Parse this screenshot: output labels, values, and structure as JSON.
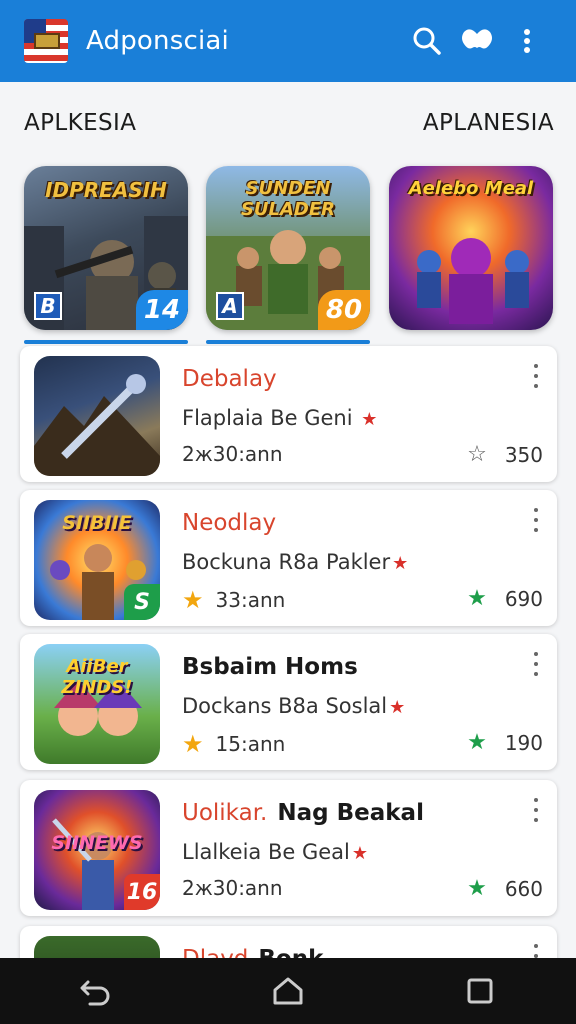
{
  "app_bar": {
    "title": "Adponsciai",
    "icons": [
      "flag-icon",
      "search-icon",
      "gamepad-icon",
      "more-vert-icon"
    ],
    "color": "#1a7fd8"
  },
  "sections": {
    "left_label": "APLKESIA",
    "right_label": "APLANESIA"
  },
  "featured": [
    {
      "title": "IDPREASIH",
      "badge_left": "B",
      "badge_right": "14",
      "accent": "#1e88e5"
    },
    {
      "title": "SUNDEN SULADER",
      "badge_left": "A",
      "badge_right": "80",
      "accent": "#f29a18"
    },
    {
      "title": "Aelebo Meal",
      "badge_left": "",
      "badge_right": "",
      "accent": "#b23ac7"
    }
  ],
  "list": [
    {
      "name": "Debalay",
      "name_extra": "",
      "name_style": "red",
      "subtitle": "Flaplaia Be Geni",
      "meta": "2ж30:ann",
      "meta_star": false,
      "count": "350",
      "count_star_color": "#555",
      "count_star_outline": true,
      "thumb_label": "",
      "thumb_corner": ""
    },
    {
      "name": "Neodlay",
      "name_extra": "",
      "name_style": "red",
      "subtitle": "Bockuna R8a Pakler",
      "meta": "33:ann",
      "meta_star": true,
      "count": "690",
      "count_star_color": "#1e9e4a",
      "count_star_outline": false,
      "thumb_label": "SIIBIIE",
      "thumb_corner": "S"
    },
    {
      "name": "Bsbaim Homs",
      "name_extra": "",
      "name_style": "dark",
      "subtitle": "Dockans B8a Soslal",
      "meta": "15:ann",
      "meta_star": true,
      "count": "190",
      "count_star_color": "#1e9e4a",
      "count_star_outline": false,
      "thumb_label": "AiiBer ZINDS!",
      "thumb_corner": ""
    },
    {
      "name": "Uolikar.",
      "name_extra": "Nag Beakal",
      "name_style": "red",
      "subtitle": "Llalkeia Be Geal",
      "meta": "2ж30:ann",
      "meta_star": false,
      "count": "660",
      "count_star_color": "#1e9e4a",
      "count_star_outline": false,
      "thumb_label": "SIINEWS",
      "thumb_corner": "16"
    },
    {
      "name": "Dlavd",
      "name_extra": "Bonk",
      "name_style": "red",
      "subtitle": "",
      "meta": "",
      "meta_star": false,
      "count": "",
      "count_star_color": "#1e9e4a",
      "count_star_outline": false,
      "thumb_label": "",
      "thumb_corner": ""
    }
  ],
  "nav": {
    "icons": [
      "back-icon",
      "home-icon",
      "recents-icon"
    ],
    "background": "#111111"
  }
}
